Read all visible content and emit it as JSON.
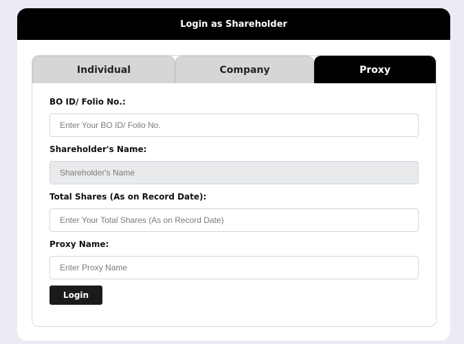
{
  "header": {
    "title": "Login as Shareholder"
  },
  "tabs": [
    {
      "label": "Individual",
      "active": false
    },
    {
      "label": "Company",
      "active": false
    },
    {
      "label": "Proxy",
      "active": true
    }
  ],
  "form": {
    "bo_id": {
      "label": "BO ID/ Folio No.:",
      "placeholder": "Enter Your BO ID/ Folio No."
    },
    "shareholder_name": {
      "label": "Shareholder's Name:",
      "placeholder": "Shareholder's Name"
    },
    "total_shares": {
      "label": "Total Shares (As on Record Date):",
      "placeholder": "Enter Your Total Shares (As on Record Date)"
    },
    "proxy_name": {
      "label": "Proxy Name:",
      "placeholder": "Enter Proxy Name"
    },
    "submit_label": "Login"
  },
  "colors": {
    "page_background": "#ebebf5",
    "header_background": "#000000",
    "active_tab": "#000000",
    "inactive_tab": "#d6d6d6",
    "button": "#1b1b1b",
    "readonly_input": "#e8eaec"
  }
}
